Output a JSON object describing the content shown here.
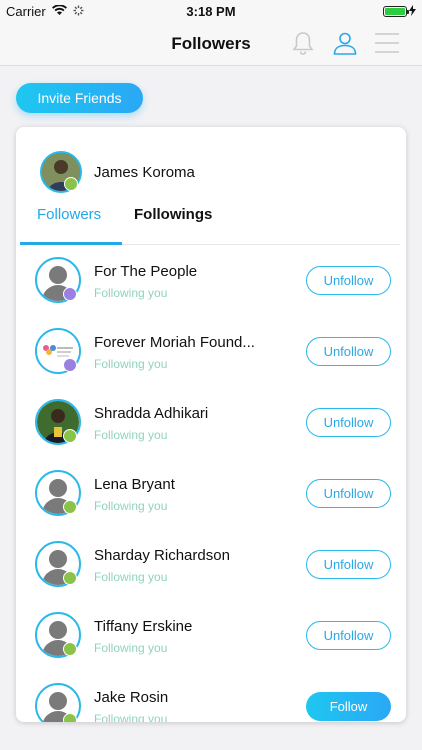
{
  "status_bar": {
    "carrier": "Carrier",
    "time": "3:18 PM"
  },
  "nav": {
    "title": "Followers"
  },
  "invite_button": "Invite Friends",
  "profile": {
    "name": "James Koroma"
  },
  "tabs": [
    {
      "label": "Followers",
      "active": true
    },
    {
      "label": "Followings",
      "active": false
    }
  ],
  "users": [
    {
      "name": "For The People",
      "status": "Following you",
      "action": "Unfollow",
      "avatar": "placeholder",
      "badge": "purple"
    },
    {
      "name": "Forever Moriah Found...",
      "status": "Following you",
      "action": "Unfollow",
      "avatar": "logo",
      "badge": "purple"
    },
    {
      "name": "Shradda Adhikari",
      "status": "Following you",
      "action": "Unfollow",
      "avatar": "photo",
      "badge": "green"
    },
    {
      "name": "Lena Bryant",
      "status": "Following you",
      "action": "Unfollow",
      "avatar": "placeholder",
      "badge": "green"
    },
    {
      "name": "Sharday Richardson",
      "status": "Following you",
      "action": "Unfollow",
      "avatar": "placeholder",
      "badge": "green"
    },
    {
      "name": "Tiffany Erskine",
      "status": "Following you",
      "action": "Unfollow",
      "avatar": "placeholder",
      "badge": "green"
    },
    {
      "name": "Jake  Rosin",
      "status": "Following you",
      "action": "Follow",
      "avatar": "placeholder",
      "badge": "green"
    }
  ],
  "colors": {
    "accent": "#2aa8f5",
    "subtitle": "#8fd3bf"
  }
}
